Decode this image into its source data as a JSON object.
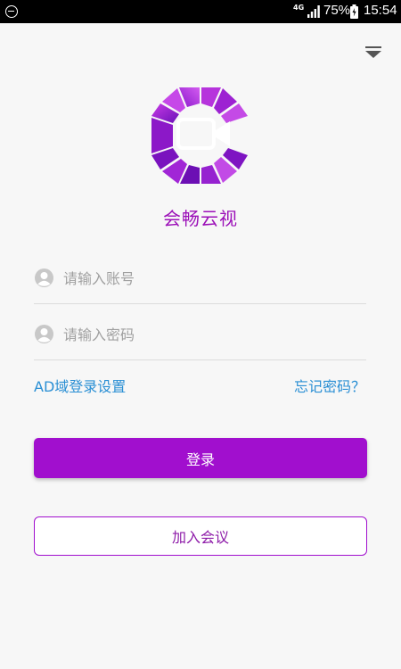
{
  "status_bar": {
    "network_type": "4G",
    "battery_percent": "75%",
    "time": "15:54",
    "icons": [
      "do-not-disturb-icon",
      "signal-icon",
      "battery-charging-icon"
    ]
  },
  "menu": {
    "icon": "dropdown-menu-icon"
  },
  "app": {
    "logo_icon": "video-camera-logo-icon",
    "name": "会畅云视"
  },
  "login_form": {
    "account_placeholder": "请输入账号",
    "account_value": "",
    "password_placeholder": "请输入密码",
    "password_value": "",
    "field_icon": "user-avatar-icon"
  },
  "links": {
    "ad_login_settings": "AD域登录设置",
    "forgot_password": "忘记密码？"
  },
  "buttons": {
    "login": "登录",
    "join_meeting": "加入会议"
  },
  "colors": {
    "accent": "#a10fce",
    "app_name": "#9c10b8",
    "link": "#2a8fd4",
    "background": "#f7f7f7"
  }
}
